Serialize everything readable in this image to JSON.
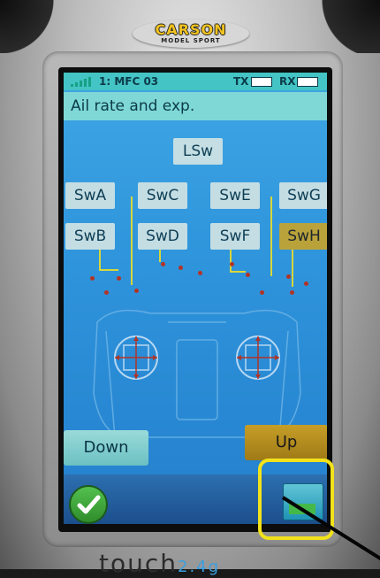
{
  "device": {
    "logo_brand": "CARSON",
    "logo_sub": "MODEL SPORT",
    "footer_brand": "touch",
    "footer_sub": "2.4g"
  },
  "status": {
    "model": "1: MFC 03",
    "tx": "TX",
    "rx": "RX"
  },
  "page": {
    "title": "Ail rate and exp."
  },
  "switches": {
    "lsw": "LSw",
    "swa": "SwA",
    "swb": "SwB",
    "swc": "SwC",
    "swd": "SwD",
    "swe": "SwE",
    "swf": "SwF",
    "swg": "SwG",
    "swh": "SwH"
  },
  "buttons": {
    "down": "Down",
    "up": "Up"
  },
  "colors": {
    "screen_bg": "#2f95dc",
    "title_bar": "#7fd8d6",
    "active_switch": "#c9a42a",
    "highlight": "#f2e21b"
  },
  "icons": {
    "confirm": "checkmark-icon",
    "page": "page-icon"
  }
}
